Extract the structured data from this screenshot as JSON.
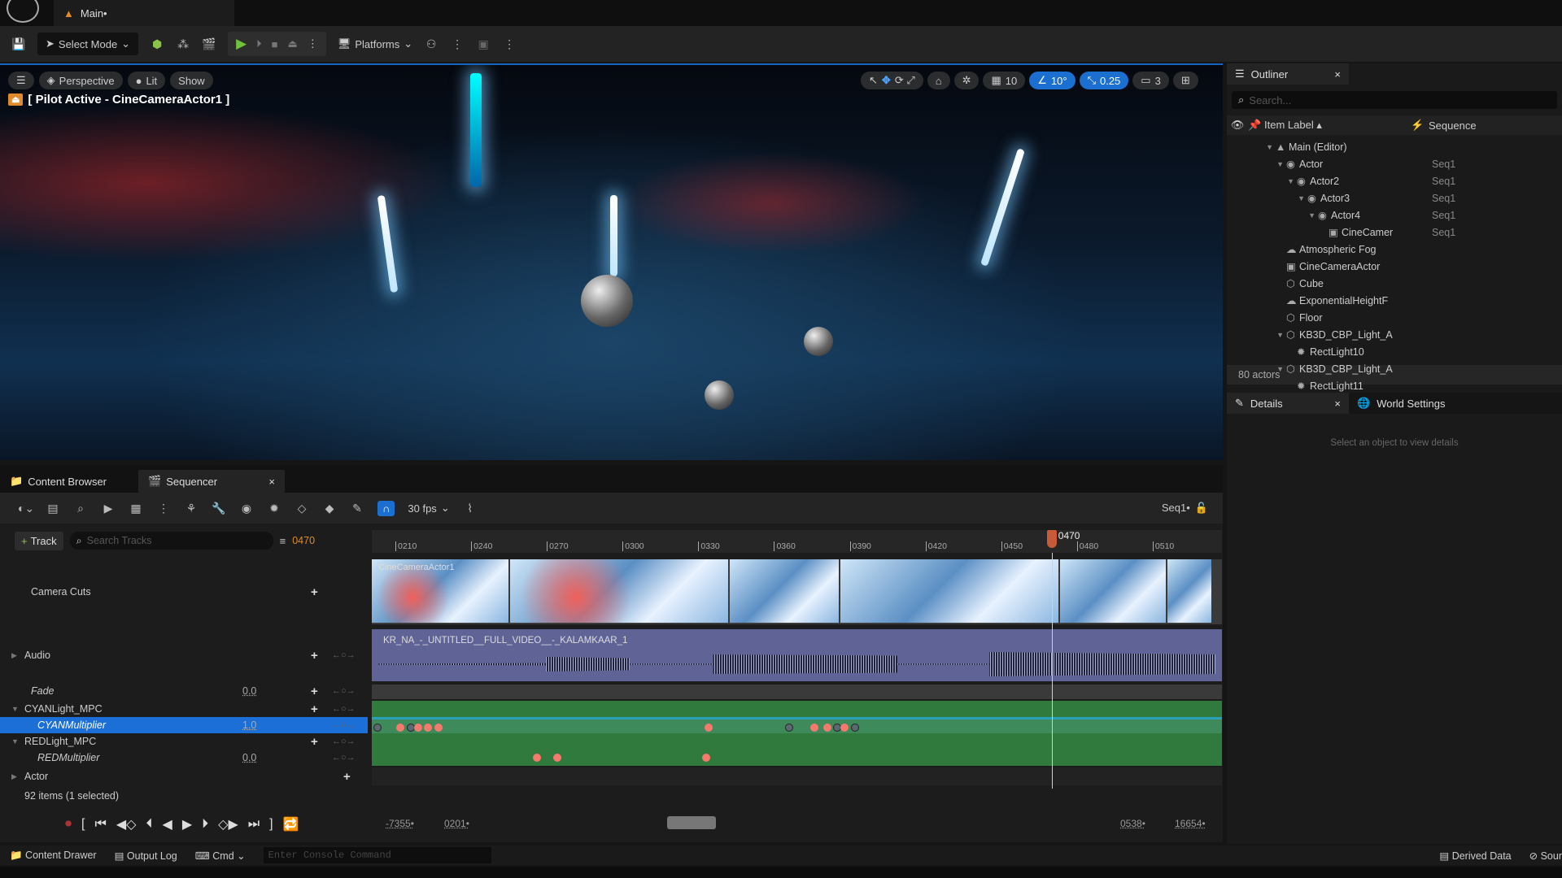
{
  "titlebar": {
    "tab": "Main•"
  },
  "toolbar": {
    "select_mode": "Select Mode",
    "platforms": "Platforms"
  },
  "viewport": {
    "perspective": "Perspective",
    "lit": "Lit",
    "show": "Show",
    "pilot": "[ Pilot Active - CineCameraActor1 ]",
    "grid": "10",
    "rot": "10°",
    "scale": "0.25",
    "cam": "3"
  },
  "outliner": {
    "tab": "Outliner",
    "search_placeholder": "Search...",
    "col_label": "Item Label ▴",
    "col_seq": "Sequence",
    "items": [
      {
        "label": "Main (Editor)",
        "seq": "",
        "icon": "level-icon",
        "depth": 0,
        "arrow": true
      },
      {
        "label": "Actor",
        "seq": "Seq1",
        "icon": "actor-icon",
        "depth": 1,
        "arrow": true
      },
      {
        "label": "Actor2",
        "seq": "Seq1",
        "icon": "actor-icon",
        "depth": 2,
        "arrow": true
      },
      {
        "label": "Actor3",
        "seq": "Seq1",
        "icon": "actor-icon",
        "depth": 3,
        "arrow": true
      },
      {
        "label": "Actor4",
        "seq": "Seq1",
        "icon": "actor-icon",
        "depth": 4,
        "arrow": true
      },
      {
        "label": "CineCamer",
        "seq": "Seq1",
        "icon": "camera-icon",
        "depth": 5,
        "arrow": false
      },
      {
        "label": "Atmospheric Fog",
        "seq": "",
        "icon": "fog-icon",
        "depth": 1,
        "arrow": false
      },
      {
        "label": "CineCameraActor",
        "seq": "",
        "icon": "camera-icon",
        "depth": 1,
        "arrow": false
      },
      {
        "label": "Cube",
        "seq": "",
        "icon": "mesh-icon",
        "depth": 1,
        "arrow": false
      },
      {
        "label": "ExponentialHeightF",
        "seq": "",
        "icon": "fog-icon",
        "depth": 1,
        "arrow": false
      },
      {
        "label": "Floor",
        "seq": "",
        "icon": "mesh-icon",
        "depth": 1,
        "arrow": false
      },
      {
        "label": "KB3D_CBP_Light_A",
        "seq": "",
        "icon": "mesh-icon",
        "depth": 1,
        "arrow": true
      },
      {
        "label": "RectLight10",
        "seq": "",
        "icon": "light-icon",
        "depth": 2,
        "arrow": false
      },
      {
        "label": "KB3D_CBP_Light_A",
        "seq": "",
        "icon": "mesh-icon",
        "depth": 1,
        "arrow": true
      },
      {
        "label": "RectLight11",
        "seq": "",
        "icon": "light-icon",
        "depth": 2,
        "arrow": false
      }
    ],
    "count": "80 actors"
  },
  "details": {
    "tab": "Details",
    "world_tab": "World Settings",
    "empty": "Select an object to view details"
  },
  "bottom_tabs": {
    "content_browser": "Content Browser",
    "sequencer": "Sequencer"
  },
  "sequencer": {
    "fps": "30 fps",
    "seq_name": "Seq1•",
    "track_btn": "Track",
    "search_placeholder": "Search Tracks",
    "current_frame": "0470",
    "playhead_frame": 470,
    "ticks": [
      "0210",
      "0240",
      "0270",
      "0300",
      "0330",
      "0360",
      "0390",
      "0420",
      "0450",
      "0480",
      "0510"
    ],
    "tracks": [
      {
        "name": "Camera Cuts",
        "value": "",
        "italic": false
      },
      {
        "name": "Audio",
        "value": "",
        "italic": false
      },
      {
        "name": "Fade",
        "value": "0.0",
        "italic": true
      },
      {
        "name": "CYANLight_MPC",
        "value": "",
        "italic": false
      },
      {
        "name": "CYANMultiplier",
        "value": "1.0",
        "italic": true
      },
      {
        "name": "REDLight_MPC",
        "value": "",
        "italic": false
      },
      {
        "name": "REDMultiplier",
        "value": "0.0",
        "italic": true
      },
      {
        "name": "Actor",
        "value": "",
        "italic": false
      }
    ],
    "camera_clip": "CineCameraActor1",
    "audio_clip": "KR_NA_-_UNTITLED__FULL_VIDEO__-_KALAMKAAR_1",
    "cyan_keys": [
      203,
      212,
      216,
      219,
      223,
      227,
      334,
      366,
      376,
      381,
      385,
      388,
      392
    ],
    "red_keys": [
      266,
      274,
      333
    ],
    "items_status": "92 items (1 selected)",
    "range": {
      "start_outer": "-7355•",
      "start": "0201•",
      "end": "0538•",
      "end_outer": "16654•"
    },
    "colors": {
      "audio": "#5f6396",
      "float_track": "#2f7a3c",
      "selected": "#1c6fd6",
      "key": "#f47a6e"
    }
  },
  "statusbar": {
    "content_drawer": "Content Drawer",
    "output_log": "Output Log",
    "cmd": "Cmd",
    "console_placeholder": "Enter Console Command",
    "derived_data": "Derived Data",
    "source": "Sour"
  }
}
